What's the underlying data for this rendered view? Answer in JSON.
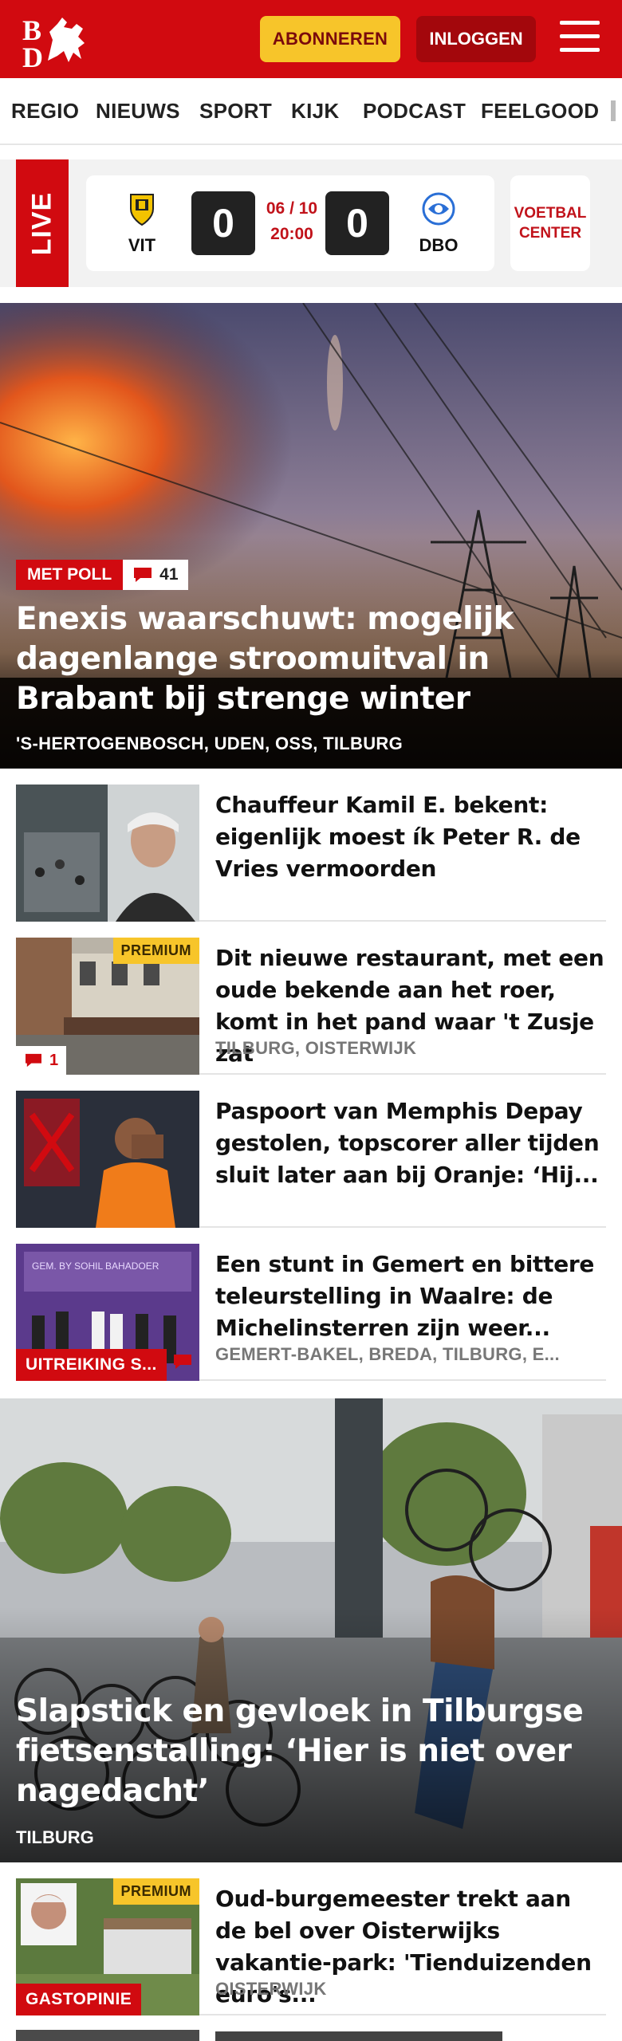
{
  "header": {
    "logo_text": "BD",
    "subscribe_label": "ABONNEREN",
    "login_label": "INLOGGEN"
  },
  "nav": {
    "items": [
      "REGIO",
      "NIEUWS",
      "SPORT",
      "KIJK",
      "PODCAST",
      "FEELGOOD"
    ]
  },
  "live": {
    "label": "LIVE",
    "home_team": "VIT",
    "away_team": "DBO",
    "home_score": "0",
    "away_score": "0",
    "date": "06 / 10",
    "time": "20:00",
    "center_label_1": "VOETBAL",
    "center_label_2": "CENTER"
  },
  "hero": {
    "badge": "MET POLL",
    "comments": "41",
    "title": "Enexis waarschuwt: mogelijk dagenlange stroomuitval in Brabant bij strenge winter",
    "tags": "'S-HERTOGENBOSCH, UDEN, OSS, TILBURG"
  },
  "articles": [
    {
      "title": "Chauffeur Kamil E. bekent: eigenlijk moest ík Peter R. de Vries vermoorden",
      "tags": ""
    },
    {
      "title": "Dit nieuwe restaurant, met een oude bekende aan het roer, komt in het pand waar 't Zusje zat",
      "tags": "TILBURG, OISTERWIJK",
      "premium": "PREMIUM",
      "comments": "1"
    },
    {
      "title": "Paspoort van Memphis Depay gestolen, topscorer aller tijden sluit later aan bij Oranje: ‘Hij...",
      "tags": ""
    },
    {
      "title": "Een stunt in Gemert en bittere teleurstelling in Waalre: de Michelinsterren zijn weer...",
      "tags": "GEMERT-BAKEL, BREDA, TILBURG, E...",
      "badge": "UITREIKING S..."
    }
  ],
  "hero2": {
    "title": "Slapstick en gevloek in Tilburgse fietsenstalling: ‘Hier is niet over nagedacht’",
    "tags": "TILBURG"
  },
  "article_last": {
    "title": "Oud-burgemeester trekt aan de bel over Oisterwijks vakantie-park: 'Tienduizenden euro's...",
    "tags": "OISTERWIJK",
    "premium": "PREMIUM",
    "badge": "GASTOPINIE"
  },
  "colors": {
    "brand_red": "#d10a10",
    "premium_yellow": "#f7c52a"
  }
}
